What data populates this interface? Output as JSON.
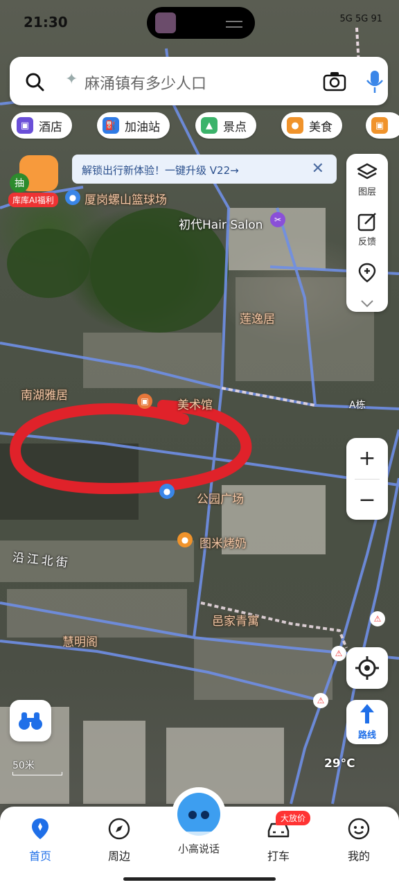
{
  "status_bar": {
    "time": "21:30",
    "right_text": "5G 5G 91"
  },
  "search": {
    "placeholder": "麻涌镇有多少人口"
  },
  "chips": [
    {
      "label": "酒店",
      "color": "#6a4fd8",
      "icon": "hotel-icon"
    },
    {
      "label": "加油站",
      "color": "#2f7be6",
      "icon": "gas-station-icon"
    },
    {
      "label": "景点",
      "color": "#3bb36a",
      "icon": "scenic-icon"
    },
    {
      "label": "美食",
      "color": "#f0932b",
      "icon": "food-icon"
    }
  ],
  "banner": {
    "text": "解锁出行新体验！一键升级 V22→"
  },
  "ai_badge": {
    "chou": "抽",
    "label": "库库AI福利"
  },
  "tools": {
    "layers": "图层",
    "feedback": "反馈"
  },
  "map_labels": {
    "basketball": "厦岗螺山篮球场",
    "salon": "初代Hair Salon",
    "lianyi": "莲逸居",
    "nanhu": "南湖雅居",
    "art": "美术馆",
    "park": "公园广场",
    "tumi": "图米烤奶",
    "street": "沿江北街",
    "yijia": "邑家青寓",
    "huiming": "慧明阁",
    "a_building": "A栋"
  },
  "scale": "50米",
  "temperature": "29°C",
  "tabs": [
    {
      "label": "首页",
      "icon": "home-icon",
      "active": true
    },
    {
      "label": "周边",
      "icon": "compass-icon",
      "active": false
    },
    {
      "label": "打车",
      "icon": "car-icon",
      "active": false
    },
    {
      "label": "我的",
      "icon": "profile-icon",
      "active": false
    }
  ],
  "center_tab": "小高说话",
  "promo": "大放价",
  "route_label": "路线",
  "colors": {
    "accent": "#1f6fe8",
    "road": "#6f8fe6",
    "annotation": "#e0222a"
  }
}
